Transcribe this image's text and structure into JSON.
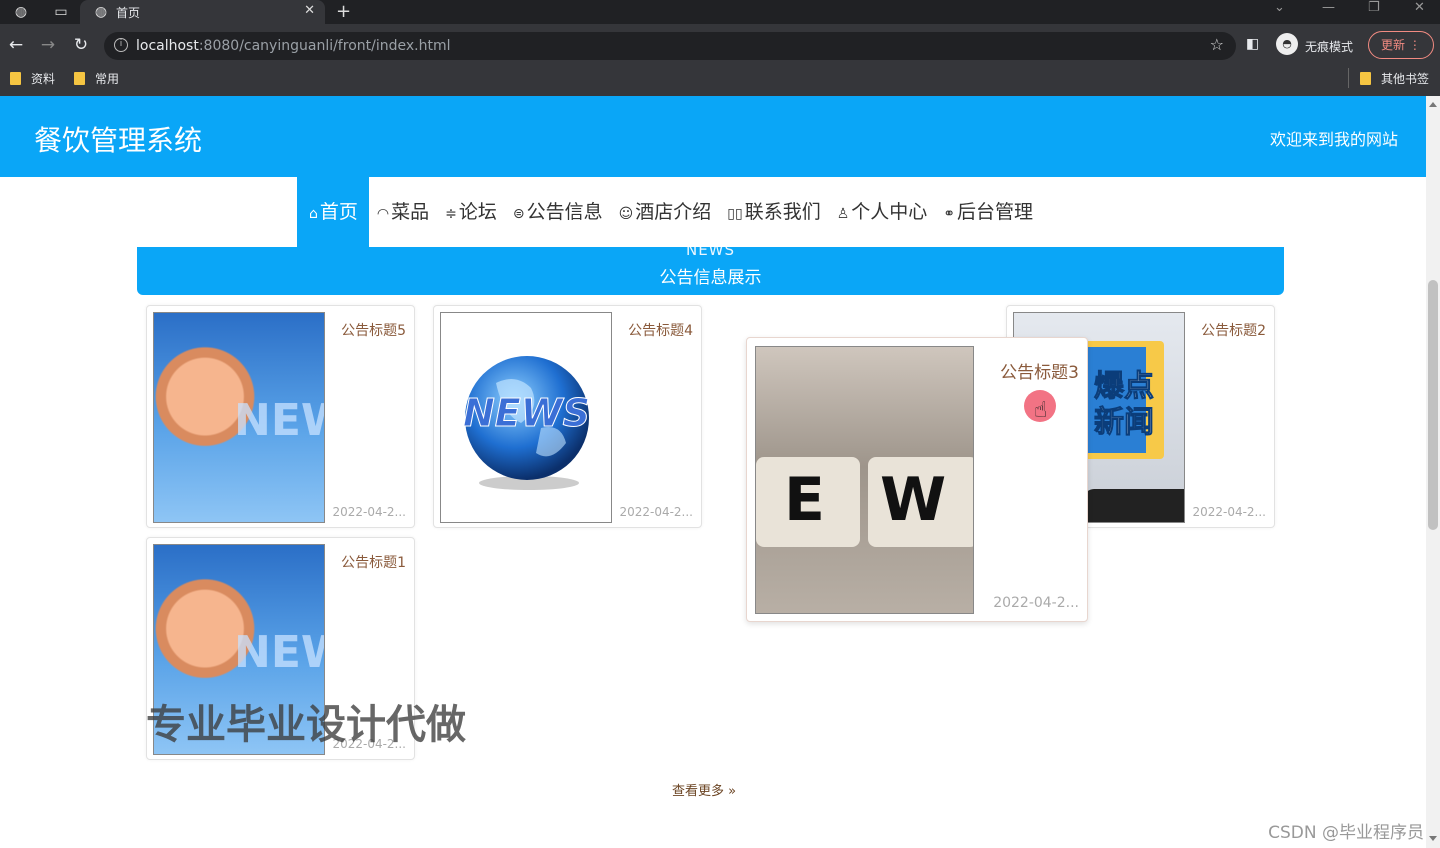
{
  "browser": {
    "tab_title": "首页",
    "url_host": "localhost",
    "url_rest": ":8080/canyinguanli/front/index.html",
    "incognito_label": "无痕模式",
    "update_label": "更新",
    "bookmarks": [
      "资料",
      "常用"
    ],
    "other_bookmarks": "其他书签"
  },
  "header": {
    "site_title": "餐饮管理系统",
    "welcome": "欢迎来到我的网站"
  },
  "nav": {
    "items": [
      {
        "icon": "⌂",
        "label": "首页"
      },
      {
        "icon": "◠",
        "label": "菜品"
      },
      {
        "icon": "≑",
        "label": "论坛"
      },
      {
        "icon": "⊜",
        "label": "公告信息"
      },
      {
        "icon": "☺",
        "label": "酒店介绍"
      },
      {
        "icon": "▯▯",
        "label": "联系我们"
      },
      {
        "icon": "♙",
        "label": "个人中心"
      },
      {
        "icon": "⚭",
        "label": "后台管理"
      }
    ]
  },
  "news_section": {
    "heading_en": "NEWS",
    "heading_cn": "公告信息展示"
  },
  "cards": [
    {
      "title": "公告标题5",
      "date": "2022-04-2..."
    },
    {
      "title": "公告标题4",
      "date": "2022-04-2..."
    },
    {
      "title": "公告标题3",
      "date": "2022-04-2..."
    },
    {
      "title": "公告标题2",
      "date": "2022-04-2..."
    },
    {
      "title": "公告标题1",
      "date": "2022-04-2..."
    }
  ],
  "image_text": {
    "news": "NEWS",
    "new": "NEW",
    "dice_e": "E",
    "dice_w": "W",
    "hot1": "爆点",
    "hot2": "新闻"
  },
  "more_label": "查看更多",
  "watermark": "专业毕业设计代做",
  "csdn_mark": "CSDN @毕业程序员",
  "colors": {
    "accent": "#0aa6f7",
    "title_text": "#8a5a3b"
  }
}
